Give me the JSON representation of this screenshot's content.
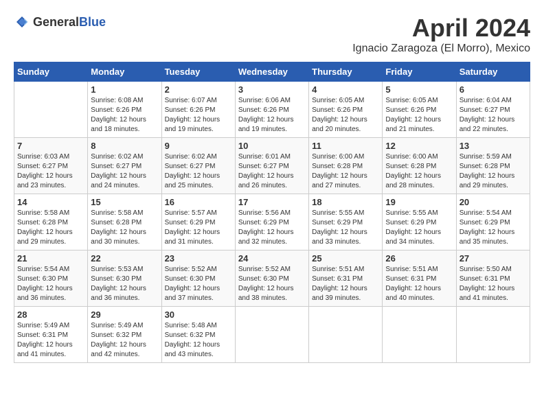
{
  "header": {
    "logo_general": "General",
    "logo_blue": "Blue",
    "month_title": "April 2024",
    "subtitle": "Ignacio Zaragoza (El Morro), Mexico"
  },
  "weekdays": [
    "Sunday",
    "Monday",
    "Tuesday",
    "Wednesday",
    "Thursday",
    "Friday",
    "Saturday"
  ],
  "weeks": [
    [
      {
        "day": "",
        "sunrise": "",
        "sunset": "",
        "daylight": ""
      },
      {
        "day": "1",
        "sunrise": "Sunrise: 6:08 AM",
        "sunset": "Sunset: 6:26 PM",
        "daylight": "Daylight: 12 hours and 18 minutes."
      },
      {
        "day": "2",
        "sunrise": "Sunrise: 6:07 AM",
        "sunset": "Sunset: 6:26 PM",
        "daylight": "Daylight: 12 hours and 19 minutes."
      },
      {
        "day": "3",
        "sunrise": "Sunrise: 6:06 AM",
        "sunset": "Sunset: 6:26 PM",
        "daylight": "Daylight: 12 hours and 19 minutes."
      },
      {
        "day": "4",
        "sunrise": "Sunrise: 6:05 AM",
        "sunset": "Sunset: 6:26 PM",
        "daylight": "Daylight: 12 hours and 20 minutes."
      },
      {
        "day": "5",
        "sunrise": "Sunrise: 6:05 AM",
        "sunset": "Sunset: 6:26 PM",
        "daylight": "Daylight: 12 hours and 21 minutes."
      },
      {
        "day": "6",
        "sunrise": "Sunrise: 6:04 AM",
        "sunset": "Sunset: 6:27 PM",
        "daylight": "Daylight: 12 hours and 22 minutes."
      }
    ],
    [
      {
        "day": "7",
        "sunrise": "Sunrise: 6:03 AM",
        "sunset": "Sunset: 6:27 PM",
        "daylight": "Daylight: 12 hours and 23 minutes."
      },
      {
        "day": "8",
        "sunrise": "Sunrise: 6:02 AM",
        "sunset": "Sunset: 6:27 PM",
        "daylight": "Daylight: 12 hours and 24 minutes."
      },
      {
        "day": "9",
        "sunrise": "Sunrise: 6:02 AM",
        "sunset": "Sunset: 6:27 PM",
        "daylight": "Daylight: 12 hours and 25 minutes."
      },
      {
        "day": "10",
        "sunrise": "Sunrise: 6:01 AM",
        "sunset": "Sunset: 6:27 PM",
        "daylight": "Daylight: 12 hours and 26 minutes."
      },
      {
        "day": "11",
        "sunrise": "Sunrise: 6:00 AM",
        "sunset": "Sunset: 6:28 PM",
        "daylight": "Daylight: 12 hours and 27 minutes."
      },
      {
        "day": "12",
        "sunrise": "Sunrise: 6:00 AM",
        "sunset": "Sunset: 6:28 PM",
        "daylight": "Daylight: 12 hours and 28 minutes."
      },
      {
        "day": "13",
        "sunrise": "Sunrise: 5:59 AM",
        "sunset": "Sunset: 6:28 PM",
        "daylight": "Daylight: 12 hours and 29 minutes."
      }
    ],
    [
      {
        "day": "14",
        "sunrise": "Sunrise: 5:58 AM",
        "sunset": "Sunset: 6:28 PM",
        "daylight": "Daylight: 12 hours and 29 minutes."
      },
      {
        "day": "15",
        "sunrise": "Sunrise: 5:58 AM",
        "sunset": "Sunset: 6:28 PM",
        "daylight": "Daylight: 12 hours and 30 minutes."
      },
      {
        "day": "16",
        "sunrise": "Sunrise: 5:57 AM",
        "sunset": "Sunset: 6:29 PM",
        "daylight": "Daylight: 12 hours and 31 minutes."
      },
      {
        "day": "17",
        "sunrise": "Sunrise: 5:56 AM",
        "sunset": "Sunset: 6:29 PM",
        "daylight": "Daylight: 12 hours and 32 minutes."
      },
      {
        "day": "18",
        "sunrise": "Sunrise: 5:55 AM",
        "sunset": "Sunset: 6:29 PM",
        "daylight": "Daylight: 12 hours and 33 minutes."
      },
      {
        "day": "19",
        "sunrise": "Sunrise: 5:55 AM",
        "sunset": "Sunset: 6:29 PM",
        "daylight": "Daylight: 12 hours and 34 minutes."
      },
      {
        "day": "20",
        "sunrise": "Sunrise: 5:54 AM",
        "sunset": "Sunset: 6:29 PM",
        "daylight": "Daylight: 12 hours and 35 minutes."
      }
    ],
    [
      {
        "day": "21",
        "sunrise": "Sunrise: 5:54 AM",
        "sunset": "Sunset: 6:30 PM",
        "daylight": "Daylight: 12 hours and 36 minutes."
      },
      {
        "day": "22",
        "sunrise": "Sunrise: 5:53 AM",
        "sunset": "Sunset: 6:30 PM",
        "daylight": "Daylight: 12 hours and 36 minutes."
      },
      {
        "day": "23",
        "sunrise": "Sunrise: 5:52 AM",
        "sunset": "Sunset: 6:30 PM",
        "daylight": "Daylight: 12 hours and 37 minutes."
      },
      {
        "day": "24",
        "sunrise": "Sunrise: 5:52 AM",
        "sunset": "Sunset: 6:30 PM",
        "daylight": "Daylight: 12 hours and 38 minutes."
      },
      {
        "day": "25",
        "sunrise": "Sunrise: 5:51 AM",
        "sunset": "Sunset: 6:31 PM",
        "daylight": "Daylight: 12 hours and 39 minutes."
      },
      {
        "day": "26",
        "sunrise": "Sunrise: 5:51 AM",
        "sunset": "Sunset: 6:31 PM",
        "daylight": "Daylight: 12 hours and 40 minutes."
      },
      {
        "day": "27",
        "sunrise": "Sunrise: 5:50 AM",
        "sunset": "Sunset: 6:31 PM",
        "daylight": "Daylight: 12 hours and 41 minutes."
      }
    ],
    [
      {
        "day": "28",
        "sunrise": "Sunrise: 5:49 AM",
        "sunset": "Sunset: 6:31 PM",
        "daylight": "Daylight: 12 hours and 41 minutes."
      },
      {
        "day": "29",
        "sunrise": "Sunrise: 5:49 AM",
        "sunset": "Sunset: 6:32 PM",
        "daylight": "Daylight: 12 hours and 42 minutes."
      },
      {
        "day": "30",
        "sunrise": "Sunrise: 5:48 AM",
        "sunset": "Sunset: 6:32 PM",
        "daylight": "Daylight: 12 hours and 43 minutes."
      },
      {
        "day": "",
        "sunrise": "",
        "sunset": "",
        "daylight": ""
      },
      {
        "day": "",
        "sunrise": "",
        "sunset": "",
        "daylight": ""
      },
      {
        "day": "",
        "sunrise": "",
        "sunset": "",
        "daylight": ""
      },
      {
        "day": "",
        "sunrise": "",
        "sunset": "",
        "daylight": ""
      }
    ]
  ]
}
